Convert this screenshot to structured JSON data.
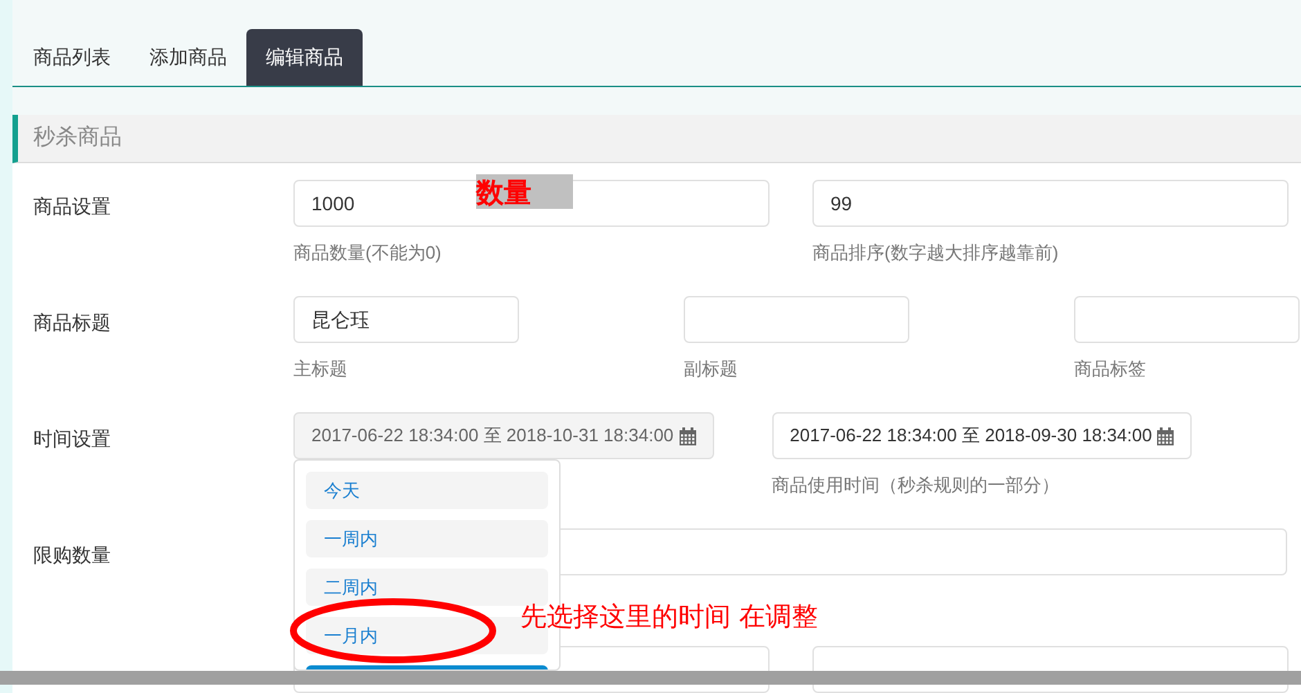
{
  "tabs": [
    {
      "label": "商品列表",
      "selected": false
    },
    {
      "label": "添加商品",
      "selected": false
    },
    {
      "label": "编辑商品",
      "selected": true
    }
  ],
  "section": {
    "title": "秒杀商品"
  },
  "rows": [
    {
      "label": "商品设置",
      "kind": "pair",
      "fields": [
        {
          "value": "1000",
          "hint": "商品数量(不能为0)"
        },
        {
          "value": "99",
          "hint": "商品排序(数字越大排序越靠前)"
        }
      ]
    },
    {
      "label": "商品标题",
      "kind": "triple",
      "fields": [
        {
          "value": "昆仑珏",
          "hint": "主标题"
        },
        {
          "hint": "副标题"
        },
        {
          "hint": "商品标签"
        }
      ]
    },
    {
      "label": "时间设置",
      "kind": "dates",
      "fields": [
        {
          "value": "2017-06-22 18:34:00 至 2018-10-31 18:34:00",
          "active": true
        },
        {
          "value": "2017-06-22 18:34:00 至 2018-09-30 18:34:00",
          "hint": "商品使用时间（秒杀规则的一部分）",
          "active": false
        }
      ]
    },
    {
      "label": "限购数量",
      "kind": "single"
    },
    {
      "kind": "blank_pair"
    }
  ],
  "dropdown": {
    "options": [
      {
        "label": "今天",
        "selected": false
      },
      {
        "label": "一周内",
        "selected": false
      },
      {
        "label": "二周内",
        "selected": false
      },
      {
        "label": "一月内",
        "selected": false
      },
      {
        "selected": true
      }
    ]
  },
  "annotations": {
    "field_note": "数量",
    "instruction": "先选择这里的时间 在调整"
  }
}
